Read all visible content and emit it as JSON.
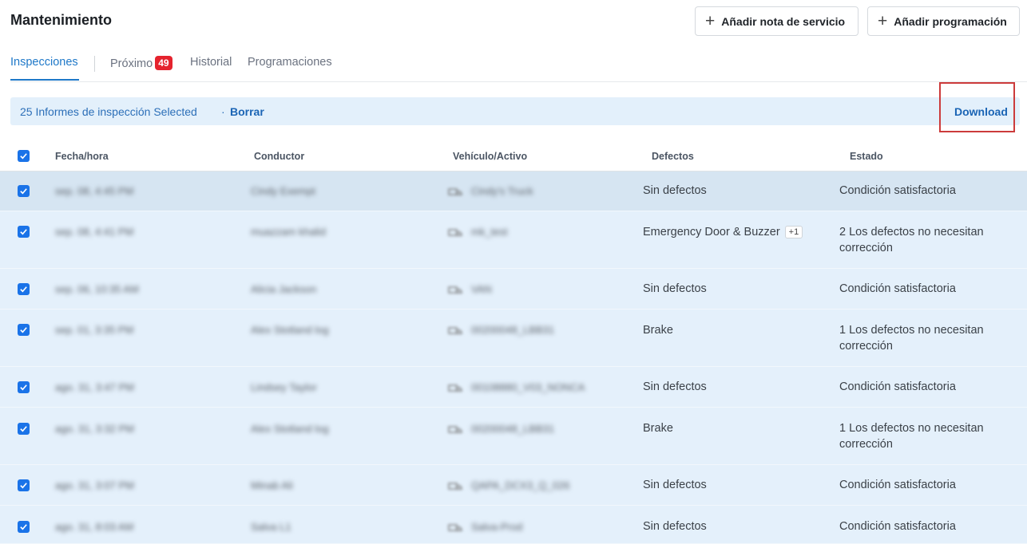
{
  "header": {
    "title": "Mantenimiento",
    "add_note_label": "Añadir nota de servicio",
    "add_schedule_label": "Añadir programación"
  },
  "tabs": [
    {
      "label": "Inspecciones",
      "active": true
    },
    {
      "label": "Próximo",
      "badge": "49"
    },
    {
      "label": "Historial"
    },
    {
      "label": "Programaciones"
    }
  ],
  "selection": {
    "count_text": "25 Informes de inspección Selected",
    "separator": "·",
    "clear_label": "Borrar",
    "download_label": "Download"
  },
  "table": {
    "columns": [
      "Fecha/hora",
      "Conductor",
      "Vehículo/Activo",
      "Defectos",
      "Estado"
    ],
    "rows": [
      {
        "date": "sep. 08, 4:45 PM",
        "driver": "Cindy Exempt",
        "vehicle": "Cindy's Truck",
        "defects": "Sin defectos",
        "defects_extra": "",
        "status": "Condición satisfactoria"
      },
      {
        "date": "sep. 08, 4:41 PM",
        "driver": "muazzam khalid",
        "vehicle": "mk_test",
        "defects": "Emergency Door & Buzzer",
        "defects_extra": "+1",
        "status": "2 Los defectos no necesitan corrección"
      },
      {
        "date": "sep. 06, 10:35 AM",
        "driver": "Alicia Jackson",
        "vehicle": "VAN",
        "defects": "Sin defectos",
        "defects_extra": "",
        "status": "Condición satisfactoria"
      },
      {
        "date": "sep. 01, 3:35 PM",
        "driver": "Alex Stotland log",
        "vehicle": "00200048_LBB31",
        "defects": "Brake",
        "defects_extra": "",
        "status": "1 Los defectos no necesitan corrección"
      },
      {
        "date": "ago. 31, 3:47 PM",
        "driver": "Lindsey Taylor",
        "vehicle": "00108880_V03_NONCA",
        "defects": "Sin defectos",
        "defects_extra": "",
        "status": "Condición satisfactoria"
      },
      {
        "date": "ago. 31, 3:32 PM",
        "driver": "Alex Stotland log",
        "vehicle": "00200048_LBB31",
        "defects": "Brake",
        "defects_extra": "",
        "status": "1 Los defectos no necesitan corrección"
      },
      {
        "date": "ago. 31, 3:07 PM",
        "driver": "Minab Ali",
        "vehicle": "QAPA_DCX3_Q_026",
        "defects": "Sin defectos",
        "defects_extra": "",
        "status": "Condición satisfactoria"
      },
      {
        "date": "ago. 31, 8:03 AM",
        "driver": "Salva L1",
        "vehicle": "Salva-Prod",
        "defects": "Sin defectos",
        "defects_extra": "",
        "status": "Condición satisfactoria"
      }
    ]
  },
  "colors": {
    "accent": "#1a73e8",
    "selection_bg": "#e3f0fb",
    "badge_red": "#e5232e",
    "highlight_border": "#cc3b3b"
  },
  "icons": {
    "add": "plus-icon",
    "checkbox": "checkbox-checked-icon",
    "vehicle": "truck-icon"
  }
}
